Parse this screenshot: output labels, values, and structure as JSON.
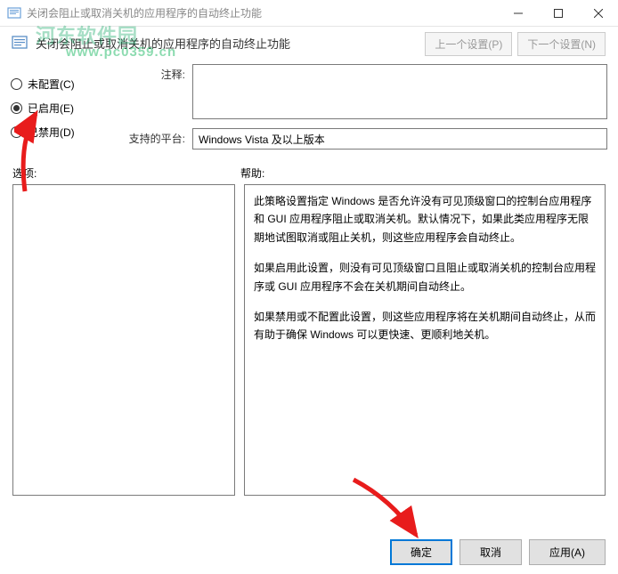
{
  "window": {
    "title": "关闭会阻止或取消关机的应用程序的自动终止功能",
    "subtitle": "关闭会阻止或取消关机的应用程序的自动终止功能"
  },
  "watermark": {
    "line1": "河东软件园",
    "line2": "www.pc0359.cn"
  },
  "nav": {
    "prev": "上一个设置(P)",
    "next": "下一个设置(N)"
  },
  "radios": {
    "notConfigured": "未配置(C)",
    "enabled": "已启用(E)",
    "disabled": "已禁用(D)"
  },
  "fields": {
    "commentLabel": "注释:",
    "platformLabel": "支持的平台:",
    "platformValue": "Windows Vista 及以上版本"
  },
  "lower": {
    "optionsLabel": "选项:",
    "helpLabel": "帮助:",
    "helpP1": "此策略设置指定 Windows 是否允许没有可见顶级窗口的控制台应用程序和 GUI 应用程序阻止或取消关机。默认情况下，如果此类应用程序无限期地试图取消或阻止关机，则这些应用程序会自动终止。",
    "helpP2": "如果启用此设置，则没有可见顶级窗口且阻止或取消关机的控制台应用程序或 GUI 应用程序不会在关机期间自动终止。",
    "helpP3": "如果禁用或不配置此设置，则这些应用程序将在关机期间自动终止，从而有助于确保 Windows 可以更快速、更顺利地关机。"
  },
  "buttons": {
    "ok": "确定",
    "cancel": "取消",
    "apply": "应用(A)"
  }
}
